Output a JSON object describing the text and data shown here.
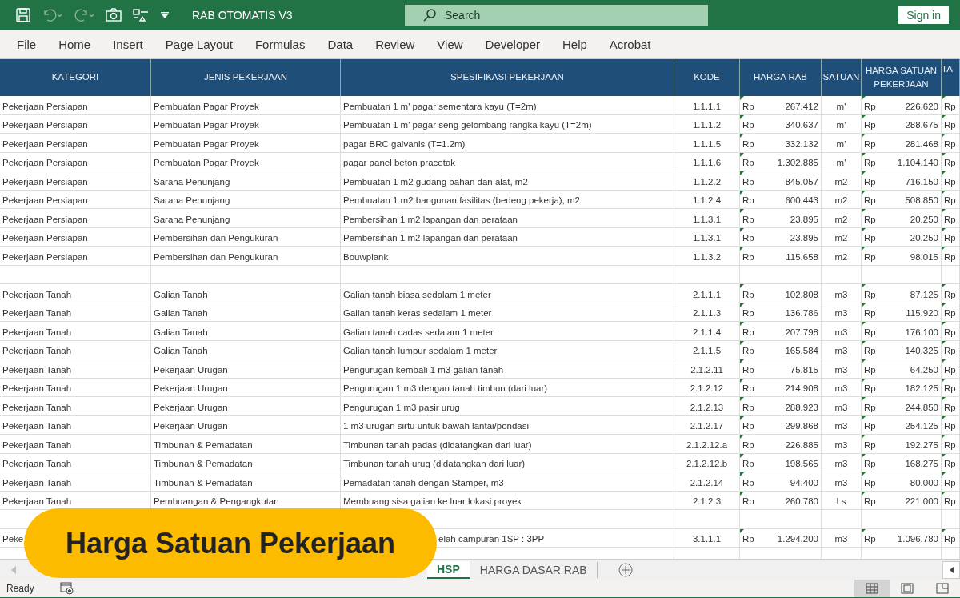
{
  "window": {
    "title": "RAB OTOMATIS V3"
  },
  "search": {
    "placeholder": "Search"
  },
  "sign_in": "Sign in",
  "menu": [
    "File",
    "Home",
    "Insert",
    "Page Layout",
    "Formulas",
    "Data",
    "Review",
    "View",
    "Developer",
    "Help",
    "Acrobat"
  ],
  "table": {
    "columns": [
      "KATEGORI",
      "JENIS PEKERJAAN",
      "SPESIFIKASI PEKERJAAN",
      "KODE",
      "HARGA RAB",
      "SATUAN",
      "HARGA SATUAN PEKERJAAN",
      "TA"
    ],
    "rows": [
      {
        "kind": "data",
        "kategori": "Pekerjaan Persiapan",
        "jenis": "Pembuatan Pagar Proyek",
        "spesifikasi": "Pembuatan 1 m' pagar sementara kayu (T=2m)",
        "kode": "1.1.1.1",
        "currency": "Rp",
        "harga_rab": "267.412",
        "satuan": "m'",
        "currency_2": "Rp",
        "harga_satuan": "226.620",
        "column_9": "Rp"
      },
      {
        "kind": "data",
        "kategori": "Pekerjaan Persiapan",
        "jenis": "Pembuatan Pagar Proyek",
        "spesifikasi": "Pembuatan 1 m' pagar seng gelombang rangka kayu (T=2m)",
        "kode": "1.1.1.2",
        "currency": "Rp",
        "harga_rab": "340.637",
        "satuan": "m'",
        "currency_2": "Rp",
        "harga_satuan": "288.675",
        "column_9": "Rp"
      },
      {
        "kind": "data",
        "kategori": "Pekerjaan Persiapan",
        "jenis": "Pembuatan Pagar Proyek",
        "spesifikasi": "pagar BRC galvanis (T=1.2m)",
        "kode": "1.1.1.5",
        "currency": "Rp",
        "harga_rab": "332.132",
        "satuan": "m'",
        "currency_2": "Rp",
        "harga_satuan": "281.468",
        "column_9": "Rp"
      },
      {
        "kind": "data",
        "kategori": "Pekerjaan Persiapan",
        "jenis": "Pembuatan Pagar Proyek",
        "spesifikasi": "pagar panel beton pracetak",
        "kode": "1.1.1.6",
        "currency": "Rp",
        "harga_rab": "1.302.885",
        "satuan": "m'",
        "currency_2": "Rp",
        "harga_satuan": "1.104.140",
        "column_9": "Rp"
      },
      {
        "kind": "data",
        "kategori": "Pekerjaan Persiapan",
        "jenis": "Sarana Penunjang",
        "spesifikasi": "Pembuatan 1 m2 gudang bahan dan alat, m2",
        "kode": "1.1.2.2",
        "currency": "Rp",
        "harga_rab": "845.057",
        "satuan": "m2",
        "currency_2": "Rp",
        "harga_satuan": "716.150",
        "column_9": "Rp"
      },
      {
        "kind": "data",
        "kategori": "Pekerjaan Persiapan",
        "jenis": "Sarana Penunjang",
        "spesifikasi": "Pembuatan 1 m2 bangunan fasilitas (bedeng pekerja), m2",
        "kode": "1.1.2.4",
        "currency": "Rp",
        "harga_rab": "600.443",
        "satuan": "m2",
        "currency_2": "Rp",
        "harga_satuan": "508.850",
        "column_9": "Rp"
      },
      {
        "kind": "data",
        "kategori": "Pekerjaan Persiapan",
        "jenis": "Sarana Penunjang",
        "spesifikasi": "Pembersihan 1 m2 lapangan dan perataan",
        "kode": "1.1.3.1",
        "currency": "Rp",
        "harga_rab": "23.895",
        "satuan": "m2",
        "currency_2": "Rp",
        "harga_satuan": "20.250",
        "column_9": "Rp"
      },
      {
        "kind": "data",
        "kategori": "Pekerjaan Persiapan",
        "jenis": "Pembersihan dan Pengukuran",
        "spesifikasi": "Pembersihan 1 m2 lapangan dan perataan",
        "kode": "1.1.3.1",
        "currency": "Rp",
        "harga_rab": "23.895",
        "satuan": "m2",
        "currency_2": "Rp",
        "harga_satuan": "20.250",
        "column_9": "Rp"
      },
      {
        "kind": "data",
        "kategori": "Pekerjaan Persiapan",
        "jenis": "Pembersihan dan Pengukuran",
        "spesifikasi": "Bouwplank",
        "kode": "1.1.3.2",
        "currency": "Rp",
        "harga_rab": "115.658",
        "satuan": "m2",
        "currency_2": "Rp",
        "harga_satuan": "98.015",
        "column_9": "Rp"
      },
      {
        "kind": "blank"
      },
      {
        "kind": "data",
        "kategori": "Pekerjaan Tanah",
        "jenis": "Galian Tanah",
        "spesifikasi": "Galian tanah biasa sedalam 1 meter",
        "kode": "2.1.1.1",
        "currency": "Rp",
        "harga_rab": "102.808",
        "satuan": "m3",
        "currency_2": "Rp",
        "harga_satuan": "87.125",
        "column_9": "Rp"
      },
      {
        "kind": "data",
        "kategori": "Pekerjaan Tanah",
        "jenis": "Galian Tanah",
        "spesifikasi": "Galian tanah keras sedalam 1 meter",
        "kode": "2.1.1.3",
        "currency": "Rp",
        "harga_rab": "136.786",
        "satuan": "m3",
        "currency_2": "Rp",
        "harga_satuan": "115.920",
        "column_9": "Rp"
      },
      {
        "kind": "data",
        "kategori": "Pekerjaan Tanah",
        "jenis": "Galian Tanah",
        "spesifikasi": "Galian tanah cadas sedalam 1 meter",
        "kode": "2.1.1.4",
        "currency": "Rp",
        "harga_rab": "207.798",
        "satuan": "m3",
        "currency_2": "Rp",
        "harga_satuan": "176.100",
        "column_9": "Rp"
      },
      {
        "kind": "data",
        "kategori": "Pekerjaan Tanah",
        "jenis": "Galian Tanah",
        "spesifikasi": "Galian tanah lumpur sedalam 1 meter",
        "kode": "2.1.1.5",
        "currency": "Rp",
        "harga_rab": "165.584",
        "satuan": "m3",
        "currency_2": "Rp",
        "harga_satuan": "140.325",
        "column_9": "Rp"
      },
      {
        "kind": "data",
        "kategori": "Pekerjaan Tanah",
        "jenis": "Pekerjaan Urugan",
        "spesifikasi": "Pengurugan kembali 1 m3 galian tanah",
        "kode": "2.1.2.11",
        "currency": "Rp",
        "harga_rab": "75.815",
        "satuan": "m3",
        "currency_2": "Rp",
        "harga_satuan": "64.250",
        "column_9": "Rp"
      },
      {
        "kind": "data",
        "kategori": "Pekerjaan Tanah",
        "jenis": "Pekerjaan Urugan",
        "spesifikasi": "Pengurugan 1 m3 dengan tanah timbun (dari luar)",
        "kode": "2.1.2.12",
        "currency": "Rp",
        "harga_rab": "214.908",
        "satuan": "m3",
        "currency_2": "Rp",
        "harga_satuan": "182.125",
        "column_9": "Rp"
      },
      {
        "kind": "data",
        "kategori": "Pekerjaan Tanah",
        "jenis": "Pekerjaan Urugan",
        "spesifikasi": "Pengurugan 1 m3 pasir urug",
        "kode": "2.1.2.13",
        "currency": "Rp",
        "harga_rab": "288.923",
        "satuan": "m3",
        "currency_2": "Rp",
        "harga_satuan": "244.850",
        "column_9": "Rp"
      },
      {
        "kind": "data",
        "kategori": "Pekerjaan Tanah",
        "jenis": "Pekerjaan Urugan",
        "spesifikasi": "1 m3 urugan sirtu untuk bawah lantai/pondasi",
        "kode": "2.1.2.17",
        "currency": "Rp",
        "harga_rab": "299.868",
        "satuan": "m3",
        "currency_2": "Rp",
        "harga_satuan": "254.125",
        "column_9": "Rp"
      },
      {
        "kind": "data",
        "kategori": "Pekerjaan Tanah",
        "jenis": "Timbunan & Pemadatan",
        "spesifikasi": "Timbunan tanah padas (didatangkan dari luar)",
        "kode": "2.1.2.12.a",
        "currency": "Rp",
        "harga_rab": "226.885",
        "satuan": "m3",
        "currency_2": "Rp",
        "harga_satuan": "192.275",
        "column_9": "Rp"
      },
      {
        "kind": "data",
        "kategori": "Pekerjaan Tanah",
        "jenis": "Timbunan & Pemadatan",
        "spesifikasi": "Timbunan tanah urug (didatangkan dari luar)",
        "kode": "2.1.2.12.b",
        "currency": "Rp",
        "harga_rab": "198.565",
        "satuan": "m3",
        "currency_2": "Rp",
        "harga_satuan": "168.275",
        "column_9": "Rp"
      },
      {
        "kind": "data",
        "kategori": "Pekerjaan Tanah",
        "jenis": "Timbunan & Pemadatan",
        "spesifikasi": "Pemadatan tanah dengan Stamper, m3",
        "kode": "2.1.2.14",
        "currency": "Rp",
        "harga_rab": "94.400",
        "satuan": "m3",
        "currency_2": "Rp",
        "harga_satuan": "80.000",
        "column_9": "Rp"
      },
      {
        "kind": "data",
        "kategori": "Pekerjaan Tanah",
        "jenis": "Pembuangan & Pengangkutan",
        "spesifikasi": "Membuang sisa galian ke luar lokasi proyek",
        "kode": "2.1.2.3",
        "currency": "Rp",
        "harga_rab": "260.780",
        "satuan": "Ls",
        "currency_2": "Rp",
        "harga_satuan": "221.000",
        "column_9": "Rp"
      },
      {
        "kind": "blank"
      },
      {
        "kind": "covered",
        "kategori": "Peke",
        "spesifikasi": "elah campuran 1SP : 3PP",
        "kode": "3.1.1.1",
        "currency": "Rp",
        "harga_rab": "1.294.200",
        "satuan": "m3",
        "currency_2": "Rp",
        "harga_satuan": "1.096.780",
        "column_9": "Rp"
      },
      {
        "kind": "blank"
      }
    ]
  },
  "banner": "Harga Satuan Pekerjaan",
  "sheet_tabs": [
    {
      "label": "HSP",
      "selected": true
    },
    {
      "label": "HARGA DASAR RAB",
      "selected": false
    }
  ],
  "status": "Ready",
  "views": [
    {
      "kind": "normal",
      "selected": true
    },
    {
      "kind": "page_layout",
      "selected": false
    },
    {
      "kind": "page_break",
      "selected": false
    }
  ]
}
